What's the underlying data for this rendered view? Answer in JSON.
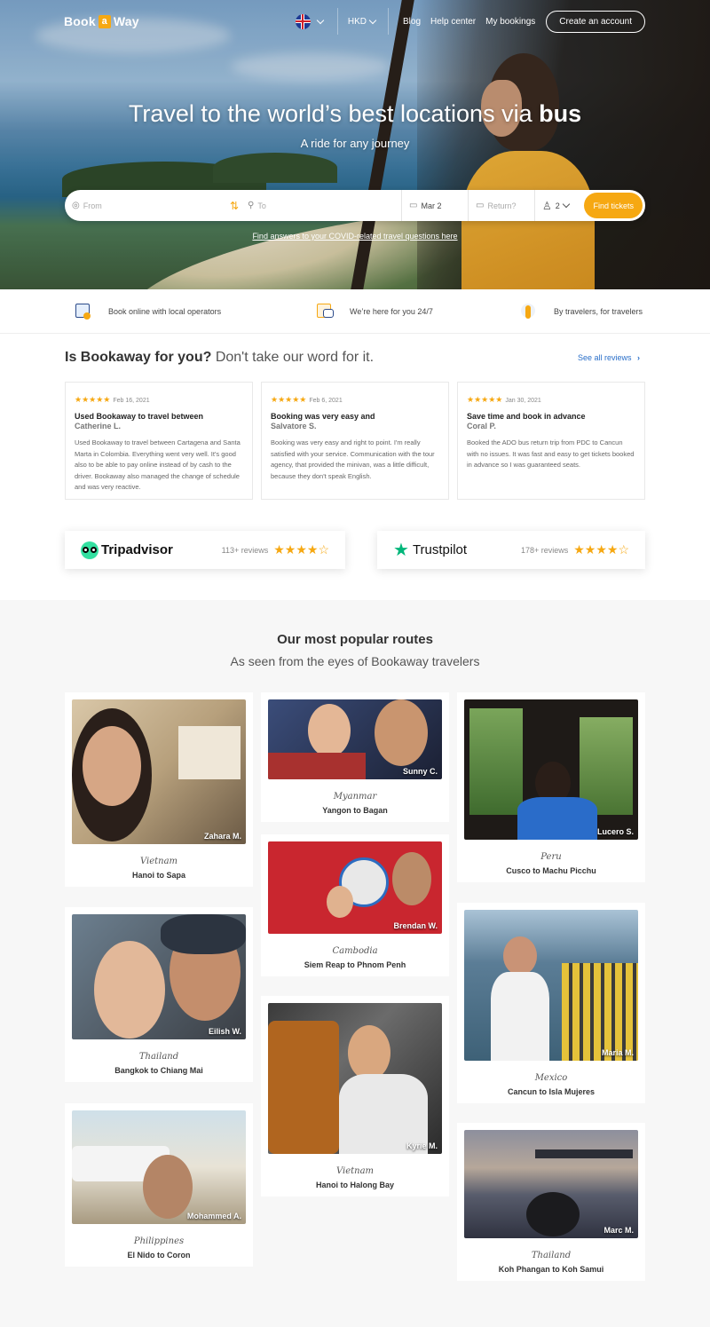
{
  "nav": {
    "logo_left": "Book",
    "logo_mid": "a",
    "logo_right": "Way",
    "currency": "HKD",
    "links": [
      "Blog",
      "Help center",
      "My bookings"
    ],
    "create_account": "Create an account"
  },
  "hero": {
    "title_prefix": "Travel to the world’s best locations via ",
    "title_bold": "bus",
    "subtitle": "A ride for any journey",
    "from_placeholder": "From",
    "to_placeholder": "To",
    "date": "Mar 2",
    "return_placeholder": "Return?",
    "passengers": "2",
    "find_button": "Find tickets",
    "covid_link": "Find answers to your COVID-related travel questions here"
  },
  "features": [
    {
      "label": "Book online with local operators",
      "icon": "bus-ticket-icon"
    },
    {
      "label": "We’re here for you 24/7",
      "icon": "support-chat-icon"
    },
    {
      "label": "By travelers, for travelers",
      "icon": "traveler-icon"
    }
  ],
  "reviews": {
    "heading_bold": "Is Bookaway for you?",
    "heading_rest": "Don't take our word for it.",
    "see_all": "See all reviews",
    "items": [
      {
        "stars": "★★★★★",
        "date": "Feb 16, 2021",
        "title": "Used Bookaway to travel between",
        "author": "Catherine L.",
        "body": "Used Bookaway to travel between Cartagena and Santa Marta in Colombia. Everything went very well. It's good also to be able to pay online instead of by cash to the driver. Bookaway also managed the change of schedule and was very reactive."
      },
      {
        "stars": "★★★★★",
        "date": "Feb 6, 2021",
        "title": "Booking was very easy and",
        "author": "Salvatore S.",
        "body": "Booking was very easy and right to point. I'm really satisfied with your service. Communication with the tour agency, that provided the minivan, was a little difficult, because they don't speak English."
      },
      {
        "stars": "★★★★★",
        "date": "Jan 30, 2021",
        "title": "Save time and book in advance",
        "author": "Coral P.",
        "body": "Booked the ADO bus return trip from PDC to Cancun with no issues. It was fast and easy to get tickets booked in advance so I was guaranteed seats."
      }
    ]
  },
  "ratings": [
    {
      "brand": "Tripadvisor",
      "count": "113+ reviews",
      "stars": "★★★★",
      "empty": "☆",
      "score": 4
    },
    {
      "brand": "Trustpilot",
      "count": "178+ reviews",
      "stars": "★★★★",
      "empty": "☆",
      "score": 4
    }
  ],
  "routes": {
    "title": "Our most popular routes",
    "subtitle": "As seen from the eyes of Bookaway travelers",
    "items": [
      {
        "country": "Vietnam",
        "route": "Hanoi to Sapa",
        "traveler": "Zahara M."
      },
      {
        "country": "Thailand",
        "route": "Bangkok to Chiang Mai",
        "traveler": "Eilish W."
      },
      {
        "country": "Philippines",
        "route": "El Nido to Coron",
        "traveler": "Mohammed A."
      },
      {
        "country": "Myanmar",
        "route": "Yangon to Bagan",
        "traveler": "Sunny C."
      },
      {
        "country": "Cambodia",
        "route": "Siem Reap to Phnom Penh",
        "traveler": "Brendan W."
      },
      {
        "country": "Vietnam",
        "route": "Hanoi to Halong Bay",
        "traveler": "Kyrie M."
      },
      {
        "country": "Peru",
        "route": "Cusco to Machu Picchu",
        "traveler": "Lucero S."
      },
      {
        "country": "Mexico",
        "route": "Cancun to Isla Mujeres",
        "traveler": "Maria M."
      },
      {
        "country": "Thailand",
        "route": "Koh Phangan to Koh Samui",
        "traveler": "Marc M."
      }
    ]
  },
  "colors": {
    "accent": "#f6a812",
    "link": "#2a6fc9",
    "trustpilot": "#00b67a",
    "tripadvisor": "#34e0a1"
  }
}
